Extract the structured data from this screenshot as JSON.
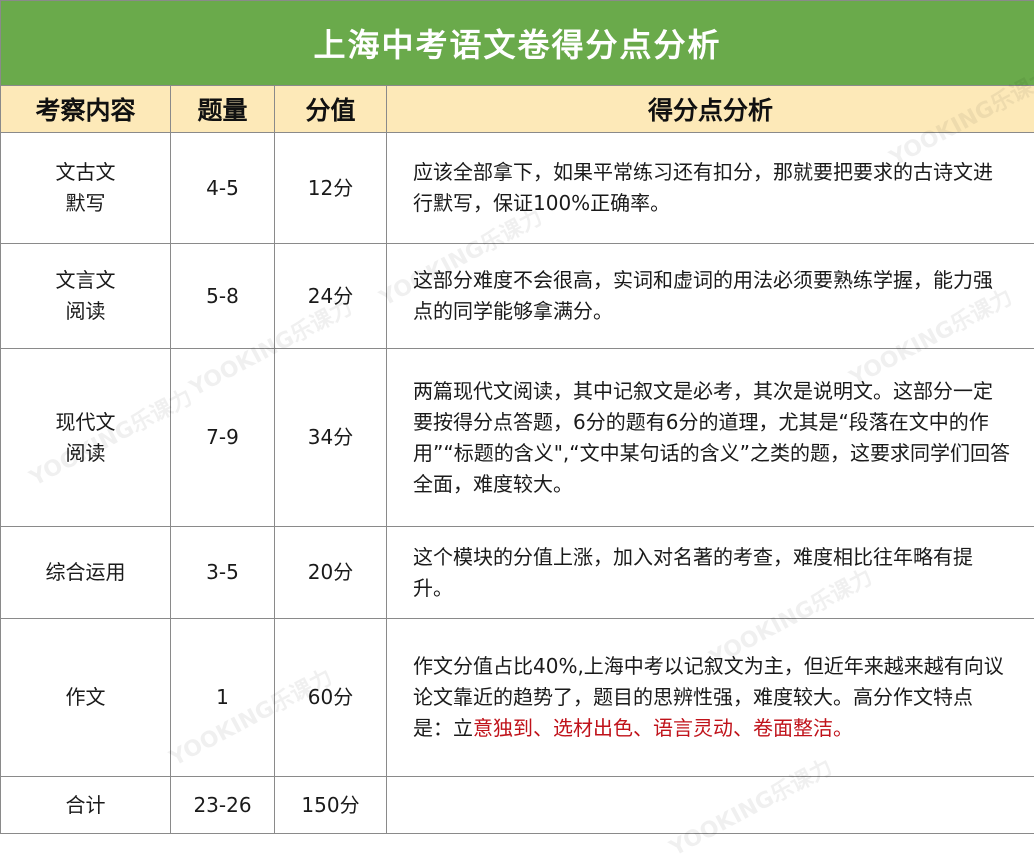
{
  "title": "上海中考语文卷得分点分析",
  "headers": [
    "考察内容",
    "题量",
    "分值",
    "得分点分析"
  ],
  "rows": [
    {
      "content_l1": "文古文",
      "content_l2": "默写",
      "count": "4-5",
      "score": "12分",
      "analysis": "应该全部拿下，如果平常练习还有扣分，那就要把要求的古诗文进行默写，保证100%正确率。",
      "analysis_red": ""
    },
    {
      "content_l1": "文言文",
      "content_l2": "阅读",
      "count": "5-8",
      "score": "24分",
      "analysis": "这部分难度不会很高，实词和虚词的用法必须要熟练学握，能力强点的同学能够拿满分。",
      "analysis_red": ""
    },
    {
      "content_l1": "现代文",
      "content_l2": "阅读",
      "count": "7-9",
      "score": "34分",
      "analysis": "两篇现代文阅读，其中记叙文是必考，其次是说明文。这部分一定要按得分点答题，6分的题有6分的道理，尤其是“段落在文中的作用”“标题的含义\",“文中某句话的含义”之类的题，这要求同学们回答全面，难度较大。",
      "analysis_red": ""
    },
    {
      "content_l1": "综合运用",
      "content_l2": "",
      "count": "3-5",
      "score": "20分",
      "analysis": "这个模块的分值上涨，加入对名著的考查，难度相比往年略有提升。",
      "analysis_red": ""
    },
    {
      "content_l1": "作文",
      "content_l2": "",
      "count": "1",
      "score": "60分",
      "analysis": "作文分值占比40%,上海中考以记叙文为主，但近年来越来越有向议论文靠近的趋势了，题目的思辨性强，难度较大。高分作文特点是：立",
      "analysis_red": "意独到、选材出色、语言灵动、卷面整洁。"
    },
    {
      "content_l1": "合计",
      "content_l2": "",
      "count": "23-26",
      "score": "150分",
      "analysis": "",
      "analysis_red": ""
    }
  ],
  "watermark": "YOOKING乐课力",
  "colors": {
    "title_bg": "#6aaa4b",
    "header_bg": "#fde9b8",
    "highlight": "#c0121a"
  }
}
